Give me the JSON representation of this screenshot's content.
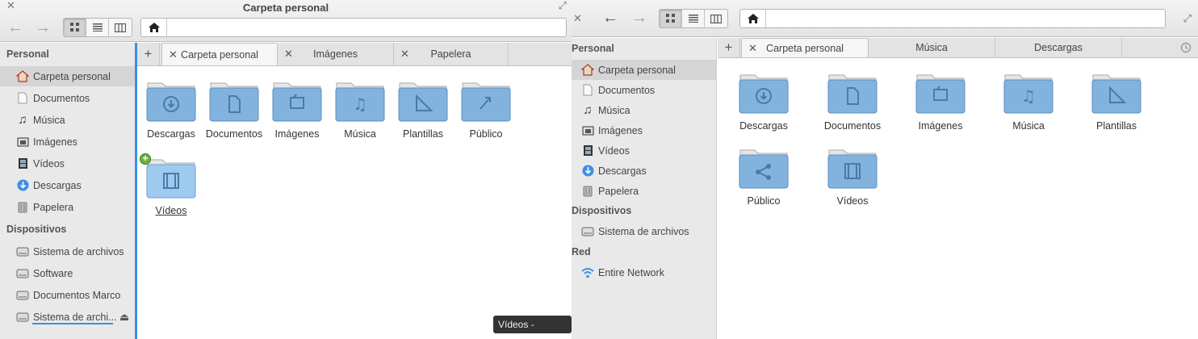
{
  "left": {
    "title": "Carpeta personal",
    "sidebar": {
      "sections": [
        "Personal",
        "Dispositivos"
      ],
      "personal": [
        {
          "label": "Carpeta personal",
          "icon": "home-icon"
        },
        {
          "label": "Documentos",
          "icon": "document-icon"
        },
        {
          "label": "Música",
          "icon": "music-icon"
        },
        {
          "label": "Imágenes",
          "icon": "pictures-icon"
        },
        {
          "label": "Vídeos",
          "icon": "video-icon"
        },
        {
          "label": "Descargas",
          "icon": "download-icon"
        },
        {
          "label": "Papelera",
          "icon": "trash-icon"
        }
      ],
      "devices": [
        {
          "label": "Sistema de archivos",
          "icon": "drive-icon"
        },
        {
          "label": "Software",
          "icon": "drive-icon"
        },
        {
          "label": "Documentos Marco",
          "icon": "drive-icon"
        },
        {
          "label": "Sistema de archi...",
          "icon": "drive-icon"
        }
      ]
    },
    "tabs": [
      "Carpeta personal",
      "Imágenes",
      "Papelera"
    ],
    "folders": [
      "Descargas",
      "Documentos",
      "Imágenes",
      "Música",
      "Plantillas",
      "Público",
      "Vídeos"
    ],
    "tooltip": "Vídeos - carpeta"
  },
  "right": {
    "sidebar": {
      "sections": [
        "Personal",
        "Dispositivos",
        "Red"
      ],
      "personal": [
        {
          "label": "Carpeta personal",
          "icon": "home-icon"
        },
        {
          "label": "Documentos",
          "icon": "document-icon"
        },
        {
          "label": "Música",
          "icon": "music-icon"
        },
        {
          "label": "Imágenes",
          "icon": "pictures-icon"
        },
        {
          "label": "Vídeos",
          "icon": "video-icon"
        },
        {
          "label": "Descargas",
          "icon": "download-icon"
        },
        {
          "label": "Papelera",
          "icon": "trash-icon"
        }
      ],
      "devices": [
        {
          "label": "Sistema de archivos",
          "icon": "drive-icon"
        }
      ],
      "network": [
        {
          "label": "Entire Network",
          "icon": "wifi-icon"
        }
      ]
    },
    "tabs": [
      "Carpeta personal",
      "Música",
      "Descargas"
    ],
    "folders": [
      "Descargas",
      "Documentos",
      "Imágenes",
      "Música",
      "Plantillas",
      "Público",
      "Vídeos"
    ]
  },
  "colors": {
    "accent": "#3d8ee8",
    "folder": "#7eb0dc",
    "sidebar_bg": "#e9e9e9"
  }
}
